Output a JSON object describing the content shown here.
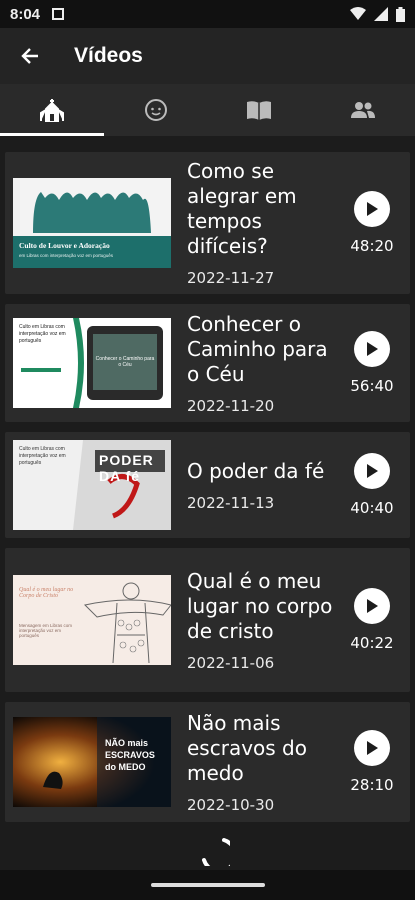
{
  "status": {
    "time": "8:04"
  },
  "header": {
    "title": "Vídeos"
  },
  "tabs": [
    {
      "icon": "church-icon",
      "selected": true
    },
    {
      "icon": "child-face-icon",
      "selected": false
    },
    {
      "icon": "book-icon",
      "selected": false
    },
    {
      "icon": "group-icon",
      "selected": false
    }
  ],
  "videos": [
    {
      "title": "Como se alegrar em tempos difíceis?",
      "date": "2022-11-27",
      "duration": "48:20",
      "thumb_text": "Culto de Louvor e Adoração",
      "thumb_sub": "em Libras com interpretação voz em português"
    },
    {
      "title": "Conhecer o Caminho para o Céu",
      "date": "2022-11-20",
      "duration": "56:40",
      "thumb_text": "Culto em Libras com interpretação voz em português",
      "thumb_sub": "Conhecer o Caminho para o Céu"
    },
    {
      "title": "O poder da fé",
      "date": "2022-11-13",
      "duration": "40:40",
      "thumb_text": "Culto em Libras com interpretação voz em português",
      "thumb_sub": "PODER DA fé"
    },
    {
      "title": "Qual é o meu lugar no corpo de cristo",
      "date": "2022-11-06",
      "duration": "40:22",
      "thumb_text": "Qual é o meu lugar no Corpo de Cristo",
      "thumb_sub": "Mensagem em Libras com interpretação voz em português"
    },
    {
      "title": "Não mais escravos do medo",
      "date": "2022-10-30",
      "duration": "28:10",
      "thumb_text": "NÃO mais ESCRAVOS do MEDO",
      "thumb_sub": ""
    }
  ]
}
